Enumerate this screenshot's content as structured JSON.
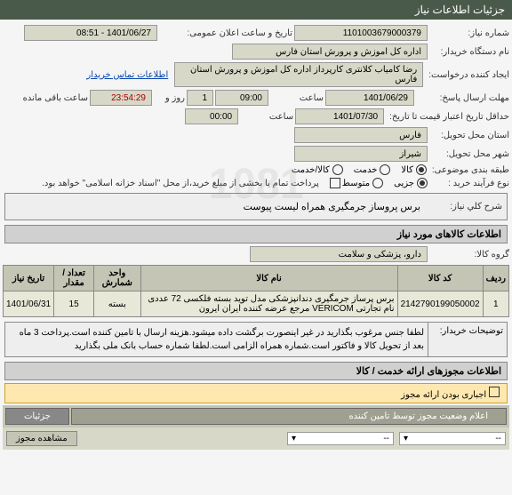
{
  "header": {
    "title": "جزئیات اطلاعات نیاز"
  },
  "fields": {
    "need_number_label": "شماره نیاز:",
    "need_number": "1101003679000379",
    "announce_label": "تاریخ و ساعت اعلان عمومی:",
    "announce_value": "1401/06/27 - 08:51",
    "buyer_label": "نام دستگاه خریدار:",
    "buyer_value": "اداره کل اموزش و پرورش استان فارس",
    "creator_label": "ایجاد کننده درخواست:",
    "creator_value": "رضا کامیاب کلانتری کارپرداز اداره کل اموزش و پرورش استان فارس",
    "contact_link": "اطلاعات تماس خریدار",
    "deadline_label": "مهلت ارسال پاسخ:",
    "deadline_date": "1401/06/29",
    "time_label": "ساعت",
    "deadline_time": "09:00",
    "day_label": "روز و",
    "day_value": "1",
    "remaining_time": "23:54:29",
    "remaining_label": "ساعت باقی مانده",
    "validity_label": "حداقل تاریخ اعتبار قیمت تا تاریخ:",
    "validity_date": "1401/07/30",
    "validity_time": "00:00",
    "province_label": "استان محل تحویل:",
    "province_value": "فارس",
    "city_label": "شهر محل تحویل:",
    "city_value": "شیراز",
    "category_label": "طبقه بندی موضوعی:",
    "cat_goods": "کالا",
    "cat_service": "خدمت",
    "cat_both": "کالا/خدمت",
    "process_label": "نوع فرآیند خرید :",
    "proc_low": "جزیی",
    "proc_med": "متوسط",
    "payment_note": "پرداخت تمام یا بخشی از مبلغ خرید،از محل \"اسناد خزانه اسلامی\" خواهد بود."
  },
  "summary": {
    "title_label": "شرح کلي نیاز:",
    "title_value": "برس پروساز جرمگیری همراه لیست پیوست"
  },
  "goods_section": "اطلاعات کالاهای مورد نیاز",
  "goods_group_label": "گروه کالا:",
  "goods_group_value": "دارو، پزشکی و سلامت",
  "table": {
    "headers": [
      "ردیف",
      "کد کالا",
      "نام کالا",
      "واحد شمارش",
      "تعداد / مقدار",
      "تاریخ نیاز"
    ],
    "rows": [
      {
        "idx": "1",
        "code": "2142790199050002",
        "name": "برس پرساز جرمگیری دندانپزشکی مدل توید بسته فلکسی 72 عددی نام تجارتی VERICOM مرجع عرضه کننده ایران ایرون",
        "unit": "بسته",
        "qty": "15",
        "date": "1401/06/31"
      }
    ]
  },
  "buyer_notes_label": "توضیحات خریدار:",
  "buyer_notes": "لطفا جنس مرغوب بگذارید در غیر اینصورت برگشت داده میشود.هزینه ارسال با تامین کننده است.پرداخت 3 ماه بعد از تحویل کالا و فاکتور است.شماره همراه الزامی است.لطفا شماره حساب بانک ملی بگذارید",
  "permit_section": "اطلاعات مجوزهای ارائه خدمت / کالا",
  "permit_mandatory_label": "اجباری بودن ارائه مجوز",
  "footer": {
    "tab1": "اعلام وضعیت مجوز توسط تامین کننده",
    "tab2": "جزئیات"
  },
  "status": {
    "select_placeholder": "--",
    "view_btn": "مشاهده مجوز"
  }
}
